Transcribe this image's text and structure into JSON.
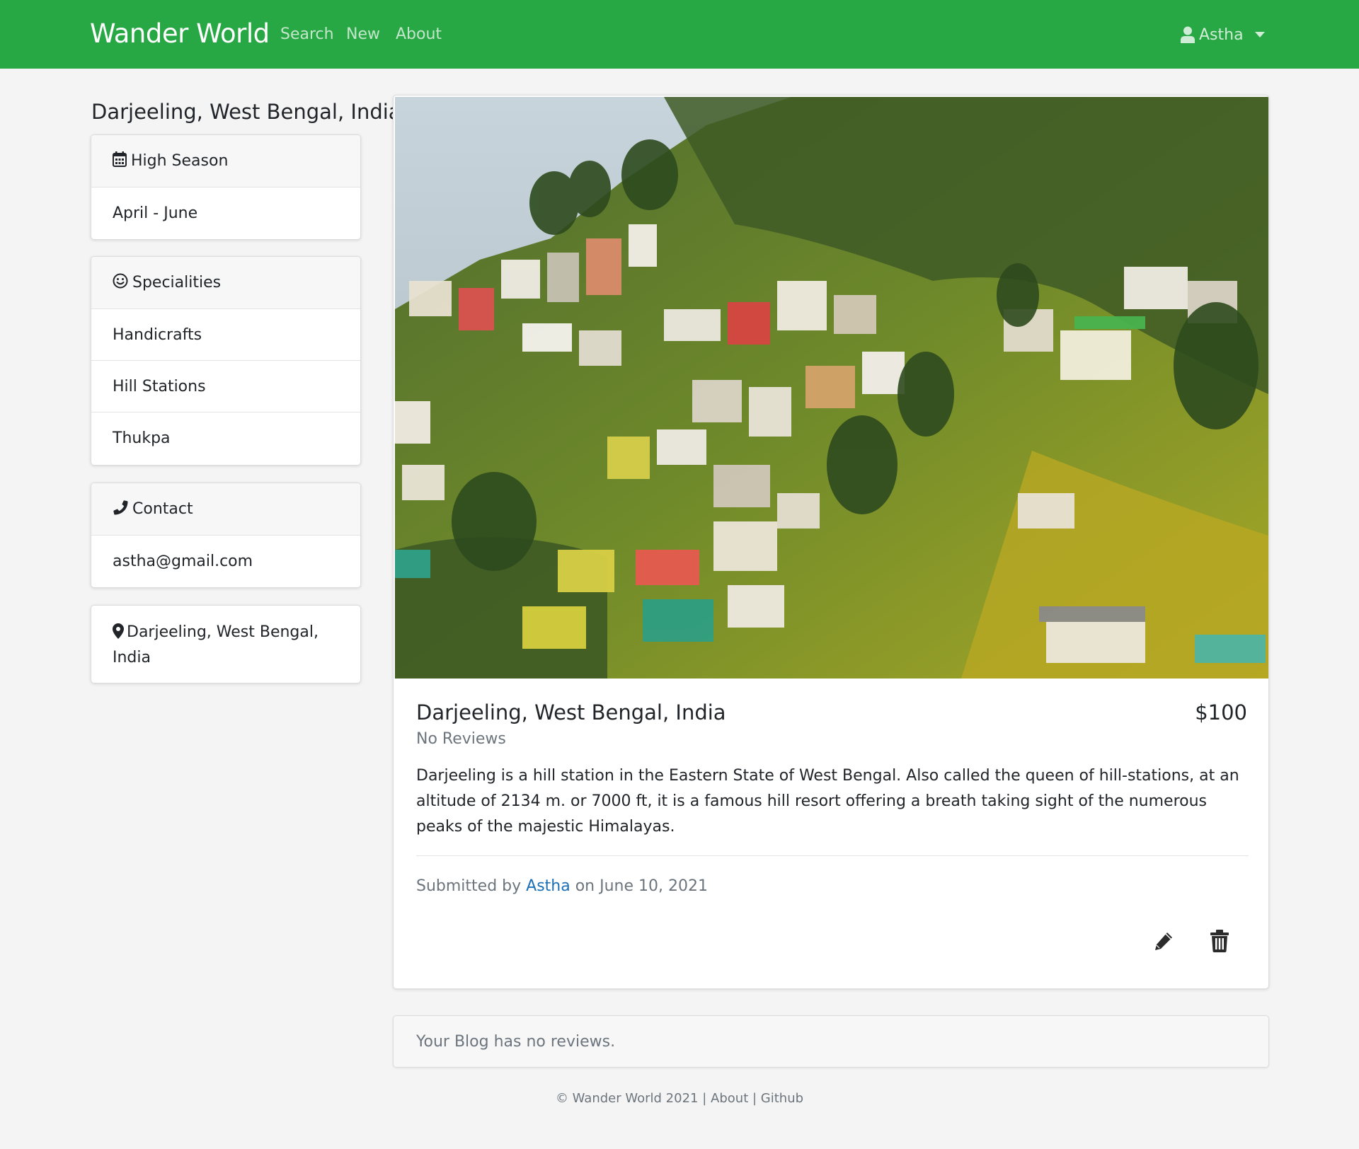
{
  "navbar": {
    "brand": "Wander World",
    "links": [
      "Search",
      "New",
      "About"
    ],
    "user": "Astha"
  },
  "sidebar": {
    "title": "Darjeeling, West Bengal, India",
    "season": {
      "header": "High Season",
      "value": "April - June"
    },
    "specialities": {
      "header": "Specialities",
      "items": [
        "Handicrafts",
        "Hill Stations",
        "Thukpa"
      ]
    },
    "contact": {
      "header": "Contact",
      "value": "astha@gmail.com"
    },
    "location": "Darjeeling, West Bengal, India"
  },
  "blog": {
    "title": "Darjeeling, West Bengal, India",
    "price": "$100",
    "reviews_text": "No Reviews",
    "description": "Darjeeling is a hill station in the Eastern State of West Bengal. Also called the queen of hill-stations, at an altitude of 2134 m. or 7000 ft, it is a famous hill resort offering a breath taking sight of the numerous peaks of the majestic Himalayas.",
    "submitted_prefix": "Submitted by",
    "author": "Astha",
    "submitted_suffix": "on June 10, 2021",
    "image_icon": "hill-town-photo"
  },
  "reviews": {
    "empty_text": "Your Blog has no reviews."
  },
  "footer": {
    "copyright": "© Wander World 2021",
    "separator": "|",
    "about": "About",
    "github": "Github"
  },
  "colors": {
    "navbar": "#28a745",
    "link": "#1a6fb5",
    "muted": "#6c757d"
  }
}
